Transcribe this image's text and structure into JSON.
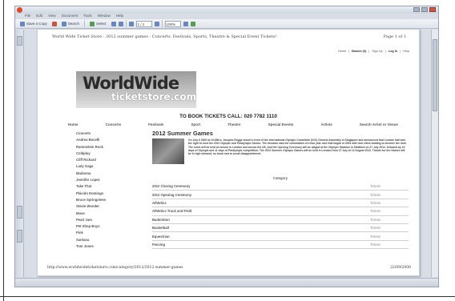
{
  "window": {
    "menu": [
      "File",
      "Edit",
      "View",
      "Document",
      "Tools",
      "Window",
      "Help"
    ]
  },
  "toolbar": {
    "save": "Save a Copy",
    "search": "Search",
    "select": "Select",
    "zoom": "100%",
    "page": "1 / 1"
  },
  "page": {
    "header_title": "World Wide Ticket Store - 2012 summer games - Concerts, Festivals, Sports, Theatre & Special Event Tickets!",
    "header_page": "Page 1 of 1",
    "top_links": [
      "Home",
      "Basket (0)",
      "Sign Up",
      "Log In",
      "Help"
    ],
    "logo_main": "WorldWide",
    "logo_sub": "ticketstore.com",
    "tickets_line": "TO BOOK TICKETS CALL: 020 7782 1110",
    "nav": [
      "Home",
      "Concerts",
      "Festivals",
      "Sport",
      "Theatre",
      "Special Events",
      "Artists",
      "Search Artist or Venue"
    ],
    "sidebar": [
      "Concerts",
      "Andrea Bocelli",
      "Rammstein Rock",
      "Coldplay",
      "Cliff Richard",
      "Lady Gaga",
      "Madonna",
      "Jennifer Lopez",
      "Take That",
      "Plácido Domingo",
      "Bruce Springsteen",
      "Stevie Wonder",
      "Muse",
      "Pearl Jam",
      "Pet Shop Boys",
      "Pink",
      "Santana",
      "Tom Jones"
    ],
    "section_title": "2012 Summer Games",
    "intro": "On July 6 2005 at 19:45hrs, Jacques Rogge stood in front of the International Olympic Committee (IOC) General Assembly in Singapore and announced that London had won the right to host the 2012 Olympic and Paralympic Games. The decision was the culmination of a two year race that began in 2003 with nine cities bidding to become the host. The event will be held at venues in London and across the UK, and the Opening Ceremony will be staged at the Olympic Stadium in Stratford on 27 July 2012, followed by 16 days of Olympic and 11 days of Paralympic competition. The 2012 Summer Olympic Games will be held in London from 27 July to 12 August 2012. Tickets for the Games will be in high demand, so book now to avoid disappointment.",
    "event_header": "Category",
    "events": [
      {
        "name": "2012 Closing Ceremony",
        "date": "",
        "link": "Tickets"
      },
      {
        "name": "2012 Opening Ceremony",
        "date": "",
        "link": "Tickets"
      },
      {
        "name": "Athletics",
        "date": "",
        "link": "Tickets"
      },
      {
        "name": "Athletics Track and Field",
        "date": "",
        "link": "Tickets"
      },
      {
        "name": "Badminton",
        "date": "",
        "link": "Tickets"
      },
      {
        "name": "Basketball",
        "date": "",
        "link": "Tickets"
      },
      {
        "name": "Equestrian",
        "date": "",
        "link": "Tickets"
      },
      {
        "name": "Fencing",
        "date": "",
        "link": "Tickets"
      }
    ],
    "footer_url": "http://www.worldwideticketstore.com/category/2012/2012-summer-games",
    "footer_date": "22/09/2008"
  }
}
